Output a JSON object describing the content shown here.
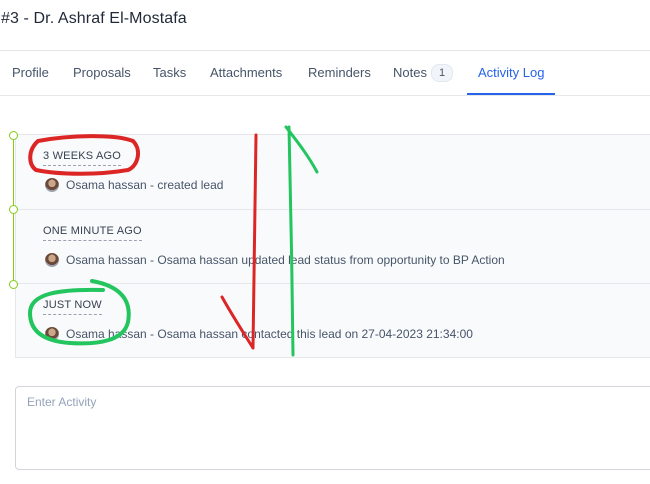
{
  "page": {
    "title": "#3 - Dr. Ashraf El-Mostafa"
  },
  "tabs": [
    {
      "label": "Profile"
    },
    {
      "label": "Proposals"
    },
    {
      "label": "Tasks"
    },
    {
      "label": "Attachments"
    },
    {
      "label": "Reminders"
    },
    {
      "label": "Notes",
      "badge": "1"
    },
    {
      "label": "Activity Log",
      "active": true
    }
  ],
  "activity_log": {
    "entries": [
      {
        "when": "3 WEEKS AGO",
        "description": "Osama hassan - created lead"
      },
      {
        "when": "ONE MINUTE AGO",
        "description": "Osama hassan - Osama hassan updated lead status from opportunity to BP Action"
      },
      {
        "when": "JUST NOW",
        "description": "Osama hassan - Osama hassan contacted this lead on 27-04-2023 21:34:00"
      }
    ]
  },
  "activity_input": {
    "placeholder": "Enter Activity",
    "value": ""
  },
  "colors": {
    "accent": "#2563eb",
    "timeline": "#84cc16",
    "annotation_red": "#dc2626",
    "annotation_green": "#22c55e"
  }
}
